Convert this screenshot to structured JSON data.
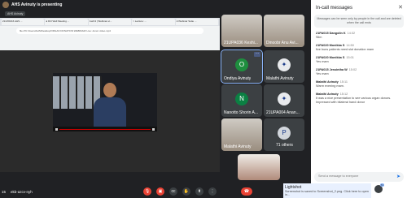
{
  "presenting": {
    "text": "AHS Avinuty is presenting"
  },
  "tag": "AHS Avinuty",
  "browser": {
    "tabs": [
      "21UPA016 AHS ...",
      "● Dtrl Well Meeting ...",
      "1s2n3 | Webinar et...",
      "> Lecture: ...",
      "A Webinar Suite ..."
    ],
    "url": "file:///C:/Users/AHS/Desktop/ORGAN DONATION WEBINAR/ Live: donor video.mp4"
  },
  "tiles": [
    {
      "name": "21UPA036 Keshi...",
      "type": "photo"
    },
    {
      "name": "Dinoobr Anu Avi...",
      "type": "photo"
    },
    {
      "name": "Ondiya Avinuty",
      "type": "avatar",
      "letter": "O",
      "color": "#1e8e3e"
    },
    {
      "name": "Malathi Avinuty",
      "type": "logo",
      "letter": "✦",
      "color": "#ffffff"
    },
    {
      "name": "Nanotto Shorin A...",
      "type": "avatar",
      "letter": "N",
      "color": "#0b8043"
    },
    {
      "name": "21UPA004 Anan...",
      "type": "logo",
      "letter": "✦",
      "color": "#ffffff"
    },
    {
      "name": "Malathi Avinuty",
      "type": "photo"
    },
    {
      "name": "71 others",
      "type": "others",
      "letter": "P"
    }
  ],
  "panel": {
    "title": "In-call messages",
    "note": "Messages can be seen only by people in the call and are deleted when the call ends",
    "messages": [
      {
        "sender": "21PA015 Dangolin K",
        "time": "14:32",
        "text": "Slim"
      },
      {
        "sender": "21PA020 Monikka S",
        "time": "14:50",
        "text": "five buns patients need slot donation mam"
      },
      {
        "sender": "21PA020 Monikka S",
        "time": "15:01",
        "text": "Yes mam"
      },
      {
        "sender": "21PA015 Jessintha W",
        "time": "15:02",
        "text": "Yes mam"
      },
      {
        "sender": "Malathi Avinuty",
        "time": "15:11",
        "text": "Warm evening mam."
      },
      {
        "sender": "Malathi Avinuty",
        "time": "15:12",
        "text": "It was a nice presentation to see various organ donors. Impressed with bilateral hand donor"
      }
    ],
    "send_placeholder": "Send a message to everyone"
  },
  "controls": {
    "time": "15",
    "code": "ekb-azcv-nyh"
  },
  "lightshot": {
    "title": "Lightshot",
    "text": "Screenshot is saved to Screenshot_2.png. Click here to open in...",
    "badge": "71"
  }
}
